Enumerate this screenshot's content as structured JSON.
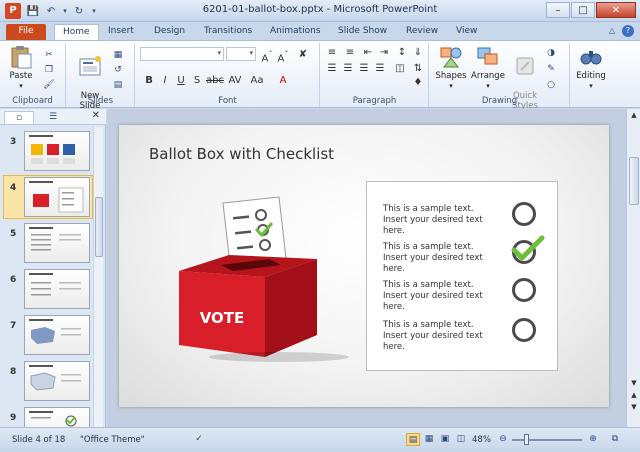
{
  "window": {
    "title": "6201-01-ballot-box.pptx - Microsoft PowerPoint",
    "app_icon_letter": "P"
  },
  "tabs": [
    {
      "label": "File"
    },
    {
      "label": "Home"
    },
    {
      "label": "Insert"
    },
    {
      "label": "Design"
    },
    {
      "label": "Transitions"
    },
    {
      "label": "Animations"
    },
    {
      "label": "Slide Show"
    },
    {
      "label": "Review"
    },
    {
      "label": "View"
    }
  ],
  "ribbon": {
    "clipboard": {
      "label": "Clipboard",
      "paste": "Paste"
    },
    "slides": {
      "label": "Slides",
      "new_slide": "New\nSlide"
    },
    "font": {
      "label": "Font"
    },
    "paragraph": {
      "label": "Paragraph"
    },
    "drawing": {
      "label": "Drawing",
      "shapes": "Shapes",
      "arrange": "Arrange",
      "quick_styles": "Quick\nStyles"
    },
    "editing": {
      "label": "Editing"
    }
  },
  "slides_panel": {
    "items": [
      {
        "num": "3"
      },
      {
        "num": "4"
      },
      {
        "num": "5"
      },
      {
        "num": "6"
      },
      {
        "num": "7"
      },
      {
        "num": "8"
      },
      {
        "num": "9"
      }
    ]
  },
  "slide": {
    "title": "Ballot Box with Checklist",
    "box_label": "VOTE",
    "items": [
      {
        "line1": "This is a sample text.",
        "line2": "Insert your desired text here.",
        "checked": false
      },
      {
        "line1": "This is a sample text.",
        "line2": "Insert your desired text here.",
        "checked": true
      },
      {
        "line1": "This is a sample text.",
        "line2": "Insert your desired text here.",
        "checked": false
      },
      {
        "line1": "This is a sample text.",
        "line2": "Insert your desired text here.",
        "checked": false
      }
    ],
    "colors": {
      "box_red": "#d81e28",
      "check_green": "#6cbf3a",
      "circle": "#4b4b4b"
    }
  },
  "status": {
    "slide_info": "Slide 4 of 18",
    "theme": "\"Office Theme\"",
    "zoom": "48%"
  }
}
